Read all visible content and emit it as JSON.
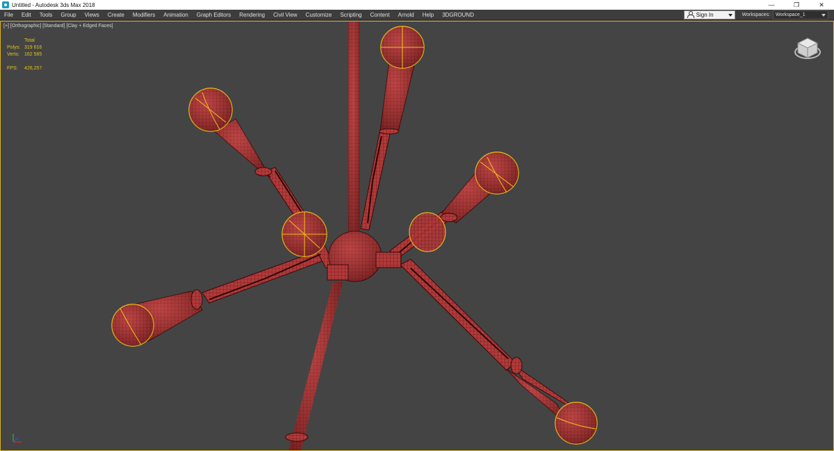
{
  "window": {
    "title": "Untitled - Autodesk 3ds Max 2018",
    "minimize": "—",
    "restore": "❐",
    "close": "✕"
  },
  "menu": {
    "items": [
      "File",
      "Edit",
      "Tools",
      "Group",
      "Views",
      "Create",
      "Modifiers",
      "Animation",
      "Graph Editors",
      "Rendering",
      "Civil View",
      "Customize",
      "Scripting",
      "Content",
      "Arnold",
      "Help",
      "3DGROUND"
    ],
    "sign_in": "Sign In",
    "workspaces_label": "Workspaces:",
    "workspace_value": "Workspace_1"
  },
  "viewport": {
    "label": "[+] [Orthographic] [Standard] [Clay + Edged Faces]",
    "border_color": "#d9b21a",
    "background": "#444444"
  },
  "stats": {
    "header": "Total",
    "polys_label": "Polys:",
    "polys_value": "319 616",
    "verts_label": "Verts:",
    "verts_value": "162 565",
    "fps_label": "FPS:",
    "fps_value": "426,257"
  },
  "scene": {
    "object_color": "#b03a3a",
    "edge_color": "#5a0e0e",
    "selection_color": "#f2c21a"
  },
  "icons": {
    "app": "3dsmax-app-icon",
    "viewcube": "viewcube-icon",
    "axis": "axis-tripod-icon"
  }
}
